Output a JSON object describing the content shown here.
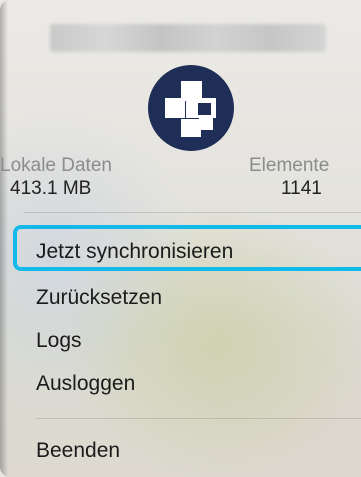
{
  "stats": {
    "local_label": "Lokale Daten",
    "local_value": "413.1 MB",
    "items_label": "Elemente",
    "items_value": "1141"
  },
  "menu": {
    "sync": "Jetzt synchronisieren",
    "reset": "Zurücksetzen",
    "logs": "Logs",
    "logout": "Ausloggen",
    "quit": "Beenden"
  },
  "colors": {
    "logo_bg": "#1f2e57",
    "highlight": "#13b9e8"
  },
  "icons": {
    "app_logo": "app-logo-icon"
  }
}
